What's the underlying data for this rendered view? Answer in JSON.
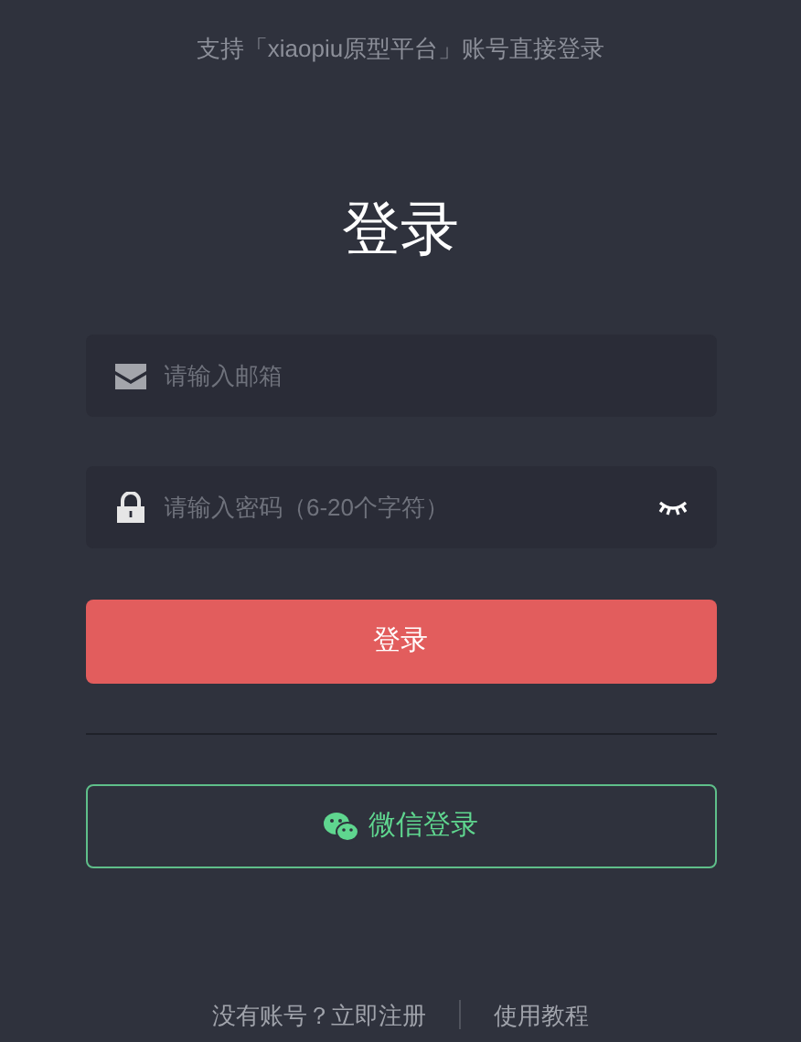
{
  "subtitle": "支持「xiaopiu原型平台」账号直接登录",
  "title": "登录",
  "email_field": {
    "placeholder": "请输入邮箱"
  },
  "password_field": {
    "placeholder": "请输入密码（6-20个字符）"
  },
  "login_button": "登录",
  "wechat_button": "微信登录",
  "footer_links": [
    "没有账号？立即注册",
    "使用教程"
  ]
}
